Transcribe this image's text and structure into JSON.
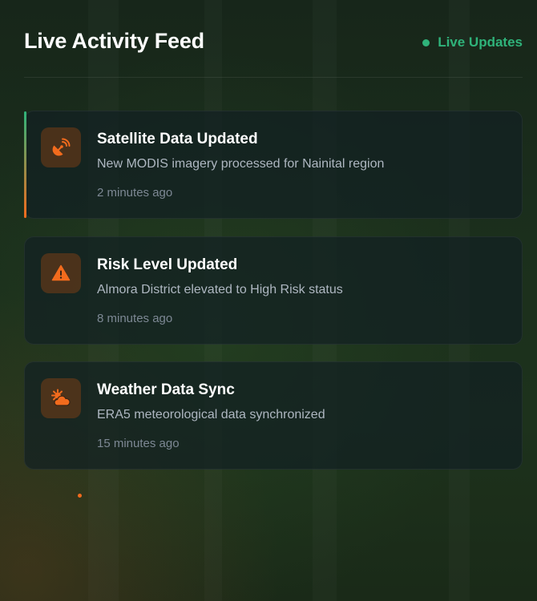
{
  "header": {
    "title": "Live Activity Feed",
    "live_label": "Live Updates"
  },
  "feed": [
    {
      "title": "Satellite Data Updated",
      "description": "New MODIS imagery processed for Nainital region",
      "time": "2 minutes ago",
      "icon": "satellite-dish-icon"
    },
    {
      "title": "Risk Level Updated",
      "description": "Almora District elevated to High Risk status",
      "time": "8 minutes ago",
      "icon": "warning-triangle-icon"
    },
    {
      "title": "Weather Data Sync",
      "description": "ERA5 meteorological data synchronized",
      "time": "15 minutes ago",
      "icon": "sun-cloud-icon"
    }
  ],
  "colors": {
    "accent_orange": "#f26b1d",
    "live_green": "#2fb37a"
  }
}
